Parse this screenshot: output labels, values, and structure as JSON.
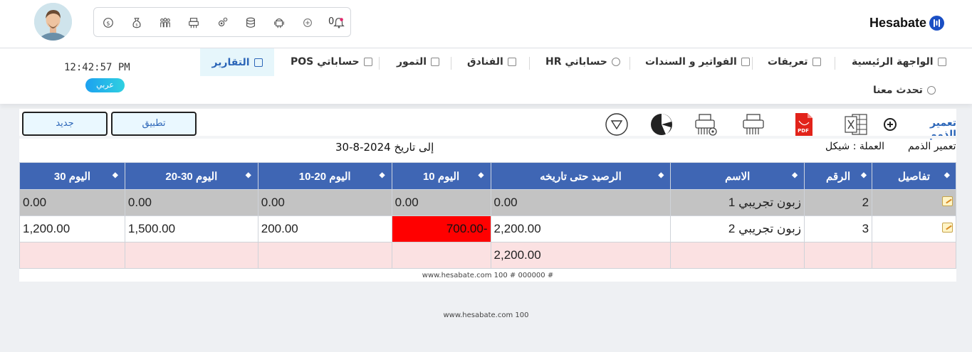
{
  "header": {
    "brand": "Hesabate",
    "notification_count": "0",
    "icons": [
      "bell-icon",
      "plus-circle-icon",
      "android-icon",
      "database-icon",
      "gear-icon",
      "printer-icon",
      "users-icon",
      "money-bag-icon",
      "coin-icon"
    ]
  },
  "nav": {
    "clock": "12:42:57 PM",
    "language_label": "عربي",
    "items": [
      {
        "label": "الواجهة الرئيسية",
        "icon": "home-icon"
      },
      {
        "label": "تعريفات",
        "icon": "layers-icon"
      },
      {
        "label": "الفواتير و السندات",
        "icon": "invoice-icon"
      },
      {
        "label": "حساباتي HR",
        "icon": "target-icon"
      },
      {
        "label": "الفنادق",
        "icon": "bed-icon"
      },
      {
        "label": "التمور",
        "icon": "dates-icon"
      },
      {
        "label": "حساباتي POS",
        "icon": "pos-icon"
      },
      {
        "label": "التقارير",
        "icon": "reports-icon"
      }
    ],
    "second_row": [
      {
        "label": "تحدث معنا",
        "icon": "chat-icon"
      }
    ]
  },
  "toolbar": {
    "new_label": "جديد",
    "apply_label": "تطبيق",
    "report_link": "تعمير الذمم",
    "tools": [
      "filter-icon",
      "pie-chart-icon",
      "print-settings-icon",
      "printer-icon",
      "pdf-icon",
      "excel-icon"
    ]
  },
  "report": {
    "name": "تعمير الذمم",
    "currency": "العملة : شيكل",
    "to_date": "إلى تاريخ 2024-8-30",
    "columns": [
      "تفاصيل",
      "الرقم",
      "الاسم",
      "الرصيد حتى تاريخه",
      "10 اليوم",
      "10-20 اليوم",
      "20-30 اليوم",
      "30 اليوم"
    ],
    "rows": [
      {
        "num": "2",
        "name": "زبون تجريبي 1",
        "balance": "0.00",
        "d10": "0.00",
        "d10_20": "0.00",
        "d20_30": "0.00",
        "d30": "0.00"
      },
      {
        "num": "3",
        "name": "زبون تجريبي 2",
        "balance": "2,200.00",
        "d10": "-700.00",
        "d10_20": "200.00",
        "d20_30": "1,500.00",
        "d30": "1,200.00"
      }
    ],
    "total_balance": "2,200.00",
    "footer": "www.hesabate.com 100 # 000000 #"
  },
  "page_footer": "www.hesabate.com 100",
  "colors": {
    "header_blue": "#3f66b4",
    "negative_red": "#ff0000",
    "total_row": "#fbe1e2",
    "accent": "#2c66b8"
  }
}
